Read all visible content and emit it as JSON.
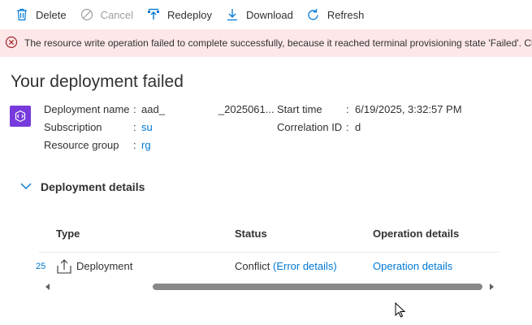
{
  "toolbar": {
    "delete_label": "Delete",
    "cancel_label": "Cancel",
    "redeploy_label": "Redeploy",
    "download_label": "Download",
    "refresh_label": "Refresh"
  },
  "error": {
    "message": "The resource write operation failed to complete successfully, because it reached terminal provisioning state 'Failed'. Click here for details"
  },
  "page": {
    "title": "Your deployment failed"
  },
  "deployment": {
    "name_label": "Deployment name",
    "name_value_prefix": "aad_",
    "name_value_suffix": "_2025061...",
    "subscription_label": "Subscription",
    "subscription_value": "su",
    "resource_group_label": "Resource group",
    "resource_group_value": "rg",
    "start_time_label": "Start time",
    "start_time_value": "6/19/2025, 3:32:57 PM",
    "correlation_label": "Correlation ID",
    "correlation_value": "d",
    "separator": ":"
  },
  "details": {
    "toggle_label": "Deployment details",
    "columns": [
      "Type",
      "Status",
      "Operation details"
    ],
    "rows": [
      {
        "index": "25",
        "type": "Deployment",
        "status": "Conflict",
        "status_link": "(Error details)",
        "operation_link": "Operation details"
      }
    ]
  },
  "colors": {
    "accent": "#0078d4",
    "error_bg": "#fde7e9",
    "error_icon": "#a4262c",
    "badge": "#773adc"
  }
}
